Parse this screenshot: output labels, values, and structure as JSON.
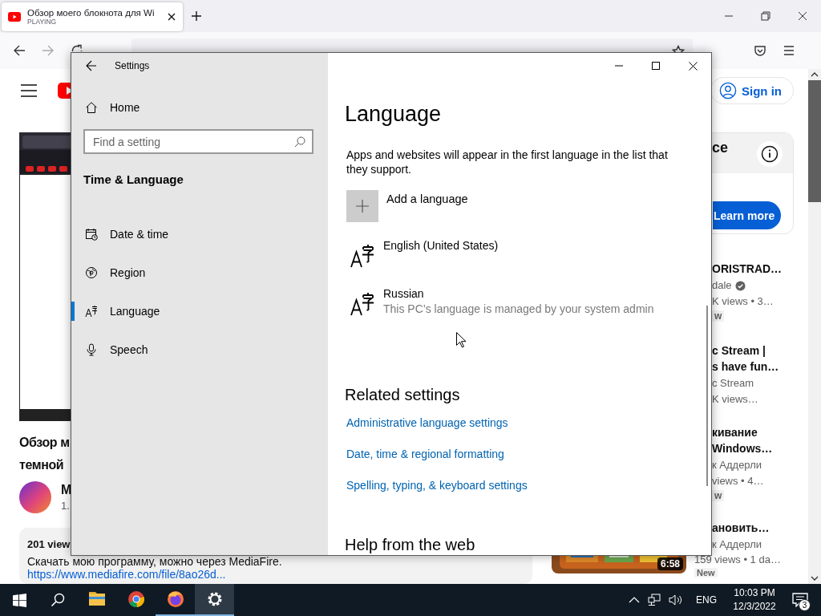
{
  "browser": {
    "tab": {
      "title": "Обзор моего блокнота для Wi",
      "status": "PLAYING"
    },
    "page": {
      "video_title": [
        "Обзор м",
        "темной"
      ],
      "channel_name": "М",
      "channel_subs": "1.",
      "description": {
        "views": "201 view",
        "text": "Скачать мою программу, можно через MediaFire.",
        "link": "https://www.mediafire.com/file/8ao26d..."
      },
      "sign_in": "Sign in",
      "promo": {
        "title": "ce",
        "button": "Learn more"
      },
      "recommendations": [
        {
          "title": [
            "ORISTRAD…"
          ],
          "channel": "dale",
          "verified": true,
          "meta": "K views  • 3…",
          "badge": "w"
        },
        {
          "title": [
            "c Stream |",
            "s have fun…"
          ],
          "channel": "c Stream",
          "verified": false,
          "meta": "K views…"
        },
        {
          "title": [
            "кивание",
            "Windows…"
          ],
          "channel": "к Аддерли",
          "verified": false,
          "meta": "views  • 4…",
          "badge": "w"
        },
        {
          "title": [
            "ановить…"
          ],
          "channel": "к Аддерли",
          "verified": false,
          "meta": "159 views  • 1 da…",
          "badge": "New",
          "thumbnail": {
            "duration": "6:58"
          }
        }
      ]
    }
  },
  "settings": {
    "title": "Settings",
    "home": "Home",
    "search": {
      "placeholder": "Find a setting"
    },
    "section": "Time & Language",
    "nav": [
      {
        "label": "Date & time",
        "kind": "calendar",
        "selected": false
      },
      {
        "label": "Region",
        "kind": "globe",
        "selected": false
      },
      {
        "label": "Language",
        "kind": "language",
        "selected": true
      },
      {
        "label": "Speech",
        "kind": "microphone",
        "selected": false
      }
    ],
    "content": {
      "heading": "Language",
      "intro": "Apps and websites will appear in the first language in the list that they support.",
      "add_language": "Add a language",
      "languages": [
        {
          "name": "English (United States)"
        },
        {
          "name": "Russian",
          "note": "This PC’s language is managed by your system admin"
        }
      ],
      "related_heading": "Related settings",
      "related_links": [
        "Administrative language settings",
        "Date, time & regional formatting",
        "Spelling, typing, & keyboard settings"
      ],
      "help_heading": "Help from the web"
    }
  },
  "taskbar": {
    "apps": [
      {
        "kind": "explorer",
        "running": false,
        "active": false
      },
      {
        "kind": "chrome",
        "running": false,
        "active": false
      },
      {
        "kind": "firefox",
        "running": true,
        "active": false
      },
      {
        "kind": "settings",
        "running": true,
        "active": true
      }
    ],
    "language": "ENG",
    "time": "10:03 PM",
    "date": "12/3/2022",
    "notifications": "3"
  }
}
